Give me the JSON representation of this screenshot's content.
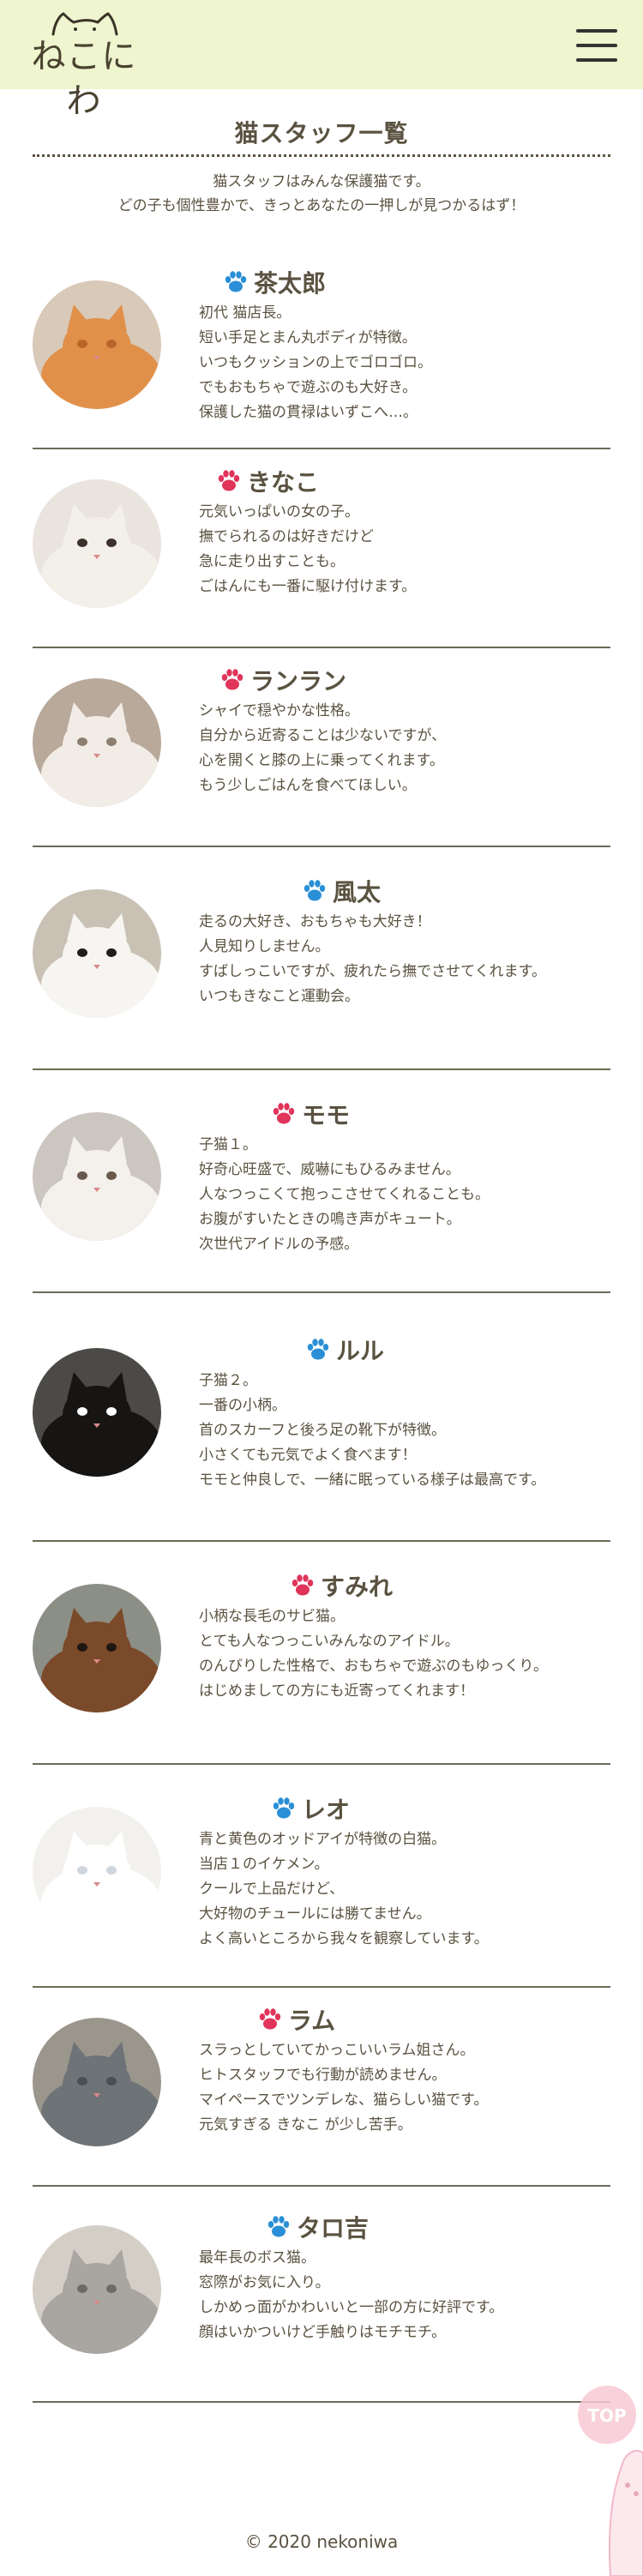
{
  "header": {
    "logo_text": "ねこにわ",
    "menu_icon": "hamburger-menu-icon"
  },
  "page": {
    "title": "猫スタッフ一覧",
    "intro_line1": "猫スタッフはみんな保護猫です。",
    "intro_line2": "どの子も個性豊かで、きっとあなたの一押しが見つかるはず！"
  },
  "colors": {
    "header_bg": "#eef5cf",
    "paw_blue": "#2a8fd6",
    "paw_pink": "#e0345a",
    "text": "#5a5240"
  },
  "cats": [
    {
      "name": "茶太郎",
      "paw": "blue",
      "lines": [
        "初代 猫店長。",
        "短い手足とまん丸ボディが特徴。",
        "いつもクッションの上でゴロゴロ。",
        "でもおもちゃで遊ぶのも大好き。",
        "保護した猫の貫禄はいずこへ…。"
      ]
    },
    {
      "name": "きなこ",
      "paw": "pink",
      "lines": [
        "元気いっぱいの女の子。",
        "撫でられるのは好きだけど",
        "急に走り出すことも。",
        "ごはんにも一番に駆け付けます。"
      ]
    },
    {
      "name": "ランラン",
      "paw": "pink",
      "lines": [
        "シャイで穏やかな性格。",
        "自分から近寄ることは少ないですが、",
        "心を開くと膝の上に乗ってくれます。",
        "もう少しごはんを食べてほしい。"
      ]
    },
    {
      "name": "風太",
      "paw": "blue",
      "lines": [
        "走るの大好き、おもちゃも大好き！",
        "人見知りしません。",
        "すばしっこいですが、疲れたら撫でさせてくれます。",
        "いつもきなこと運動会。"
      ]
    },
    {
      "name": "モモ",
      "paw": "pink",
      "lines": [
        "子猫１。",
        "好奇心旺盛で、威嚇にもひるみません。",
        "人なつっこくて抱っこさせてくれることも。",
        "お腹がすいたときの鳴き声がキュート。",
        "次世代アイドルの予感。"
      ]
    },
    {
      "name": "ルル",
      "paw": "blue",
      "lines": [
        "子猫２。",
        "一番の小柄。",
        "首のスカーフと後ろ足の靴下が特徴。",
        "小さくても元気でよく食べます！",
        "モモと仲良しで、一緒に眠っている様子は最高です。"
      ]
    },
    {
      "name": "すみれ",
      "paw": "pink",
      "lines": [
        "小柄な長毛のサビ猫。",
        "とても人なつっこいみんなのアイドル。",
        "のんびりした性格で、おもちゃで遊ぶのもゆっくり。",
        "はじめましての方にも近寄ってくれます！"
      ]
    },
    {
      "name": "レオ",
      "paw": "blue",
      "lines": [
        "青と黄色のオッドアイが特徴の白猫。",
        "当店１のイケメン。",
        "クールで上品だけど、",
        "大好物のチュールには勝てません。",
        "よく高いところから我々を観察しています。"
      ]
    },
    {
      "name": "ラム",
      "paw": "pink",
      "lines": [
        "スラっとしていてかっこいいラム姐さん。",
        "ヒトスタッフでも行動が読めません。",
        "マイペースでツンデレな、猫らしい猫です。",
        "元気すぎる きなこ が少し苦手。"
      ]
    },
    {
      "name": "タロ吉",
      "paw": "blue",
      "lines": [
        "最年長のボス猫。",
        "窓際がお気に入り。",
        "しかめっ面がかわいいと一部の方に好評です。",
        "顔はいかついけど手触りはモチモチ。"
      ]
    }
  ],
  "top_button": {
    "label": "TOP"
  },
  "footer": {
    "copyright": "© 2020 nekoniwa"
  }
}
